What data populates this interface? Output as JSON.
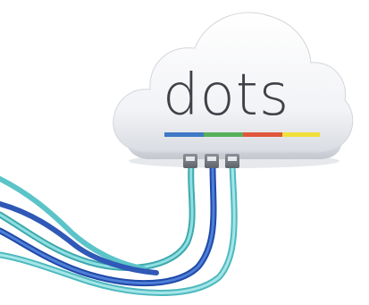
{
  "device": {
    "brand_text": "dots",
    "stripe_colors": [
      "#3f78c6",
      "#58b05b",
      "#e0573b",
      "#f1df3b"
    ]
  },
  "colors": {
    "cloud_body": "#f4f5f7",
    "cloud_shadow": "#c9ccd3",
    "base_band": "#dfe2e7",
    "cable_teal": "#5cc4c9",
    "cable_blue": "#2f58b7",
    "cable_aqua": "#7ed0d3",
    "background": "#ffffff"
  }
}
